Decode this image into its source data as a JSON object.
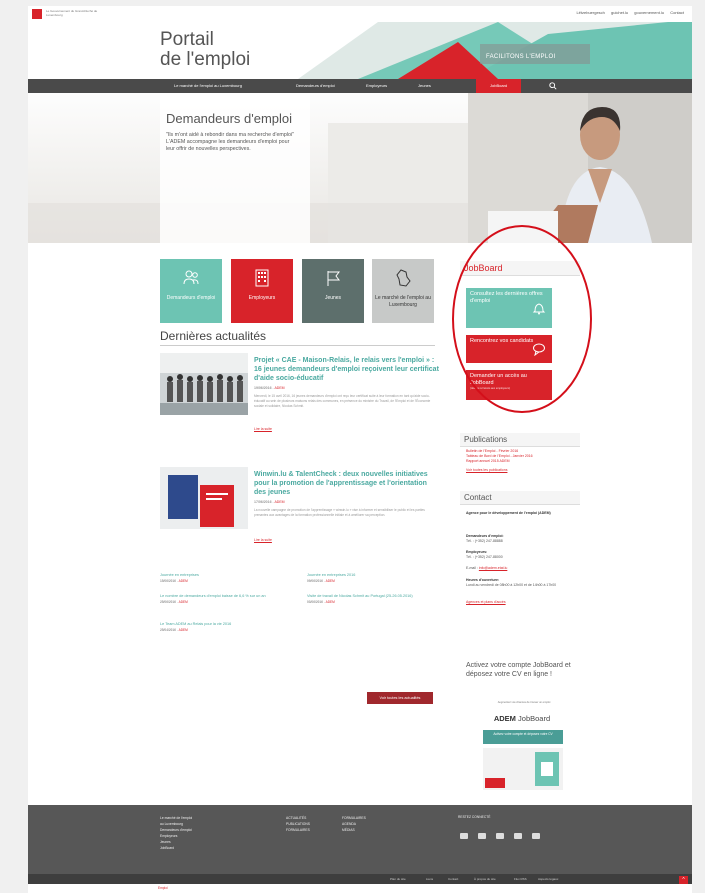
{
  "colors": {
    "accent": "#d8232a",
    "teal": "#6dc4b3",
    "grey_tile": "#5d6f6c",
    "light_grey_tile": "#c7c9c8",
    "nav": "#4a4a4a",
    "footer": "#575757"
  },
  "gov": {
    "name": "Le Gouvernement du Grand-Duché de Luxembourg"
  },
  "lang_links": [
    "Lëtzebuergesch",
    "guichet.lu",
    "gouvernement.lu",
    "Contact"
  ],
  "header": {
    "title_line1": "Portail",
    "title_line2": "de l'emploi",
    "tagline": "FACILITONS L'EMPLOI"
  },
  "nav": {
    "items": [
      "Le marché de l'emploi au Luxembourg",
      "Demandeurs d'emploi",
      "Employeurs",
      "Jeunes",
      "JobBoard"
    ],
    "search_icon": "search-icon"
  },
  "hero": {
    "title": "Demandeurs d'emploi",
    "text": "\"Ils m'ont aidé à rebondir dans ma recherche d'emploi\" L'ADEM accompagne les demandeurs d'emploi pour leur offrir de nouvelles perspectives."
  },
  "tiles": [
    {
      "label": "Demandeurs d'emploi",
      "icon": "people-icon",
      "color": "#6dc4b3"
    },
    {
      "label": "Employeurs",
      "icon": "building-icon",
      "color": "#d8232a"
    },
    {
      "label": "Jeunes",
      "icon": "flag-icon",
      "color": "#5d6f6c"
    },
    {
      "label": "Le marché de l'emploi au Luxembourg",
      "icon": "map-icon",
      "color": "#c7c9c8"
    }
  ],
  "news": {
    "section_title": "Dernières actualités",
    "articles": [
      {
        "title": "Projet « CAE - Maison-Relais, le relais vers l'emploi » : 16 jeunes demandeurs d'emploi reçoivent leur certificat d'aide socio-éducatif",
        "date": "19/06/2016",
        "tag": "ADEM",
        "body": "Mercredi, le 15 avril 2016, 16 jeunes demandeurs d'emploi ont reçu leur certificat suite à leur formation en tant qu'aide socio-éducatif au sein de plusieurs maisons relais des communes, en présence du ministre du Travail, de l'Emploi et de l'Économie sociale et solidaire, Nicolas Schmit.",
        "read_more": "Lire la suite"
      },
      {
        "title": "Winwin.lu & TalentCheck : deux nouvelles initiatives pour la promotion de l'apprentissage et l'orientation des jeunes",
        "date": "17/06/2016",
        "tag": "ADEM",
        "body": "La nouvelle campagne de promotion de l'apprentissage « winwin.lu » vise à informer et sensibiliser le public et les parties prenantes aux avantages de la formation professionnelle initiale et à améliorer sa perception.",
        "read_more": "Lire la suite"
      }
    ],
    "items": [
      {
        "title": "Journée en entreprises",
        "date": "15/06/2016",
        "tag": "ADEM"
      },
      {
        "title": "Journée en entreprises 2016",
        "date": "09/06/2016",
        "tag": "ADEM"
      },
      {
        "title": "Le nombre de demandeurs d'emploi baisse de 6,6 % sur un an",
        "date": "25/06/2016",
        "tag": "ADEM"
      },
      {
        "title": "Visite de travail de Nicolas Schmit au Portugal (25-26.05.2016)",
        "date": "03/06/2016",
        "tag": "ADEM"
      },
      {
        "title": "Le Team ADEM au Relais pour la vie 2016",
        "date": "25/04/2016",
        "tag": "ADEM"
      }
    ],
    "all_news_label": "Voir toutes les actualités"
  },
  "sidebar": {
    "jobboard_title": "JobBoard",
    "jobboard_buttons": [
      {
        "label": "Consultez les dernières offres d'emploi",
        "icon": "bell-icon",
        "color": "#6dc4b3",
        "sub": ""
      },
      {
        "label": "Rencontrez vos candidats",
        "icon": "chat-icon",
        "color": "#d8232a",
        "sub": ""
      },
      {
        "label": "Demander un accès au JobBoard",
        "icon": "",
        "color": "#d8232a",
        "sub": "(réservé à l'accès aux employeurs)"
      }
    ],
    "publications_title": "Publications",
    "publications": [
      "Bulletin de l'Emploi - Février 2016",
      "Tableau de Bord de l'Emploi - Janvier 2016",
      "Rapport annuel 2015 ADEM"
    ],
    "publications_all": "Voir toutes les publications",
    "contact_title": "Contact",
    "contact_agency": "Agence pour le développement de l'emploi (ADEM)",
    "contact_jobseekers_label": "Demandeurs d'emploi:",
    "contact_jobseekers_phone": "Tél. : (+352) 247-88888",
    "contact_employers_label": "Employeurs:",
    "contact_employers_phone": "Tél. : (+352) 247-88000",
    "contact_email_label": "E-mail :",
    "contact_email": "info@adem.etat.lu",
    "contact_hours_label": "Heures d'ouverture:",
    "contact_hours": "Lundi au vendredi de 08h00 à 12h00 et de 14h00 à 17h00",
    "contact_agencies_link": "Agences et plans d'accès",
    "promo_title": "Activez votre compte JobBoard et déposez votre CV en ligne !",
    "promo_small": "Augmentez vos chances de trouver un emploi",
    "promo_logo_bold": "ADEM",
    "promo_logo_rest": "JobBoard",
    "promo_band": "Activez votre compte et déposez votre CV"
  },
  "footer": {
    "col1": [
      "Le marché de l'emploi",
      "au Luxembourg",
      "Demandeurs d'emploi",
      "Employeurs",
      "Jeunes",
      "JobBoard"
    ],
    "col2": [
      "ACTUALITÉS",
      "PUBLICATIONS",
      "FORMULAIRES"
    ],
    "col3": [
      "FORMULAIRES",
      "AGENDA",
      "MÉDIAS"
    ],
    "follow_title": "RESTEZ CONNECTÉ",
    "legal": [
      "Plan du site",
      "Liens",
      "Contact",
      "À propos du site",
      "Flux RSS",
      "Aspects légaux"
    ],
    "bottom_logo": "Emploi"
  }
}
